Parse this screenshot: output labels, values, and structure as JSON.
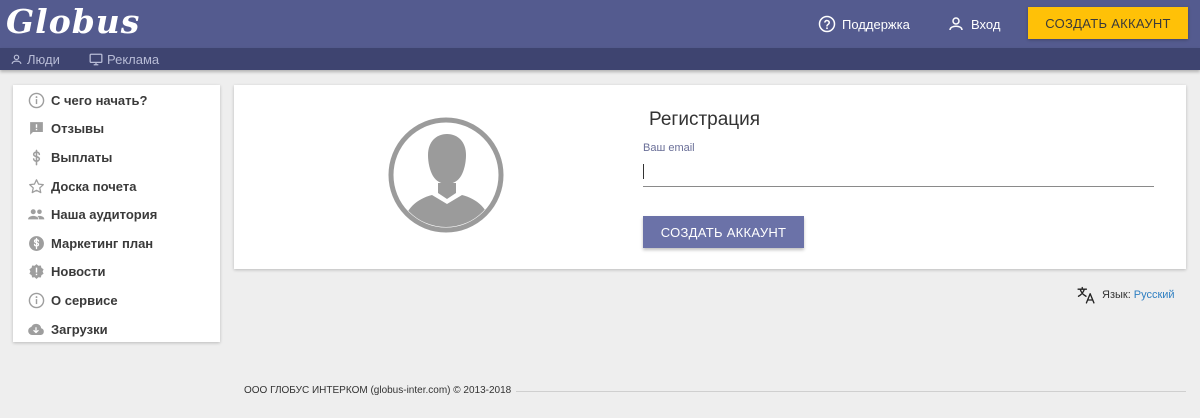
{
  "header": {
    "logo": "Globus",
    "support_label": "Поддержка",
    "login_label": "Вход",
    "create_account_label": "СОЗДАТЬ АККАУНТ"
  },
  "subnav": {
    "items": [
      {
        "label": "Люди",
        "icon": "person-icon"
      },
      {
        "label": "Реклама",
        "icon": "ads-icon"
      }
    ]
  },
  "sidebar": {
    "items": [
      {
        "label": "С чего начать?",
        "icon": "info-icon"
      },
      {
        "label": "Отзывы",
        "icon": "feedback-icon"
      },
      {
        "label": "Выплаты",
        "icon": "dollar-icon"
      },
      {
        "label": "Доска почета",
        "icon": "star-icon"
      },
      {
        "label": "Наша аудитория",
        "icon": "people-icon"
      },
      {
        "label": "Маркетинг план",
        "icon": "money-circle-icon"
      },
      {
        "label": "Новости",
        "icon": "news-badge-icon"
      },
      {
        "label": "О сервисе",
        "icon": "info-icon"
      },
      {
        "label": "Загрузки",
        "icon": "cloud-download-icon"
      }
    ]
  },
  "registration": {
    "title": "Регистрация",
    "email_label": "Ваш email",
    "email_value": "",
    "create_button_label": "СОЗДАТЬ АККАУНТ"
  },
  "language": {
    "label": "Язык:",
    "value": "Русский"
  },
  "footer": {
    "copyright": "ООО ГЛОБУС ИНТЕРКОМ (globus-inter.com) © 2013-2018"
  },
  "colors": {
    "header_bg": "#545b8f",
    "subnav_bg": "#3e4470",
    "accent_yellow": "#ffc107",
    "primary_button": "#6b72a8",
    "link_blue": "#2f7fc1"
  }
}
